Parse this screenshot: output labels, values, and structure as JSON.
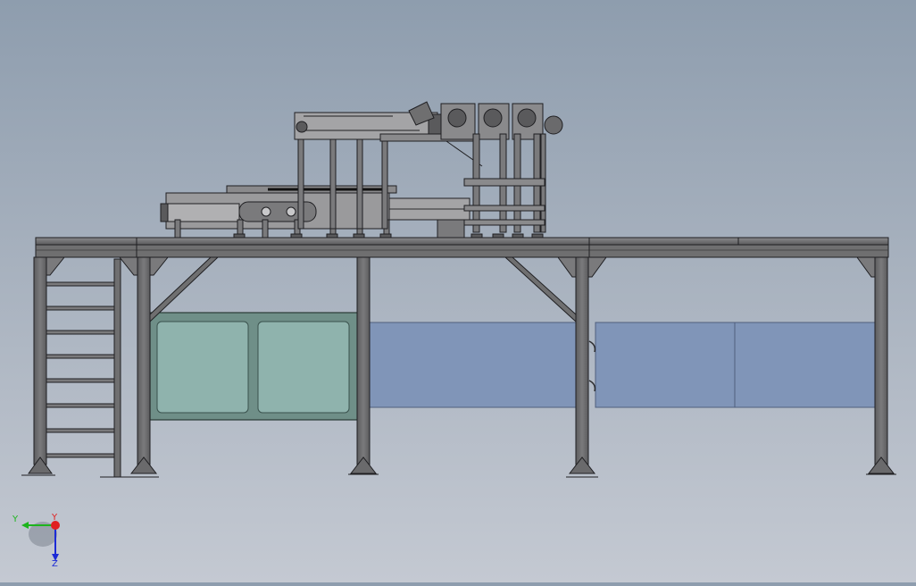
{
  "scene": {
    "name": "cad-assembly-view",
    "colors": {
      "steel": "#6f6f70",
      "steel_dark": "#4a4a4c",
      "steel_light": "#8a8a8c",
      "line": "#1f1f22",
      "glass_green": "#8fb3ad",
      "glass_green_frame": "#5f7f78",
      "panel_blue": "#8095b8",
      "panel_blue_frame": "#4f5f7d",
      "machine_light": "#9a9a9c"
    }
  },
  "triad": {
    "x_label": "Y",
    "y_label": "Y",
    "z_label": "Z",
    "x_color": "#1db41d",
    "y_color": "#e02020",
    "z_color": "#1c2bd6"
  }
}
